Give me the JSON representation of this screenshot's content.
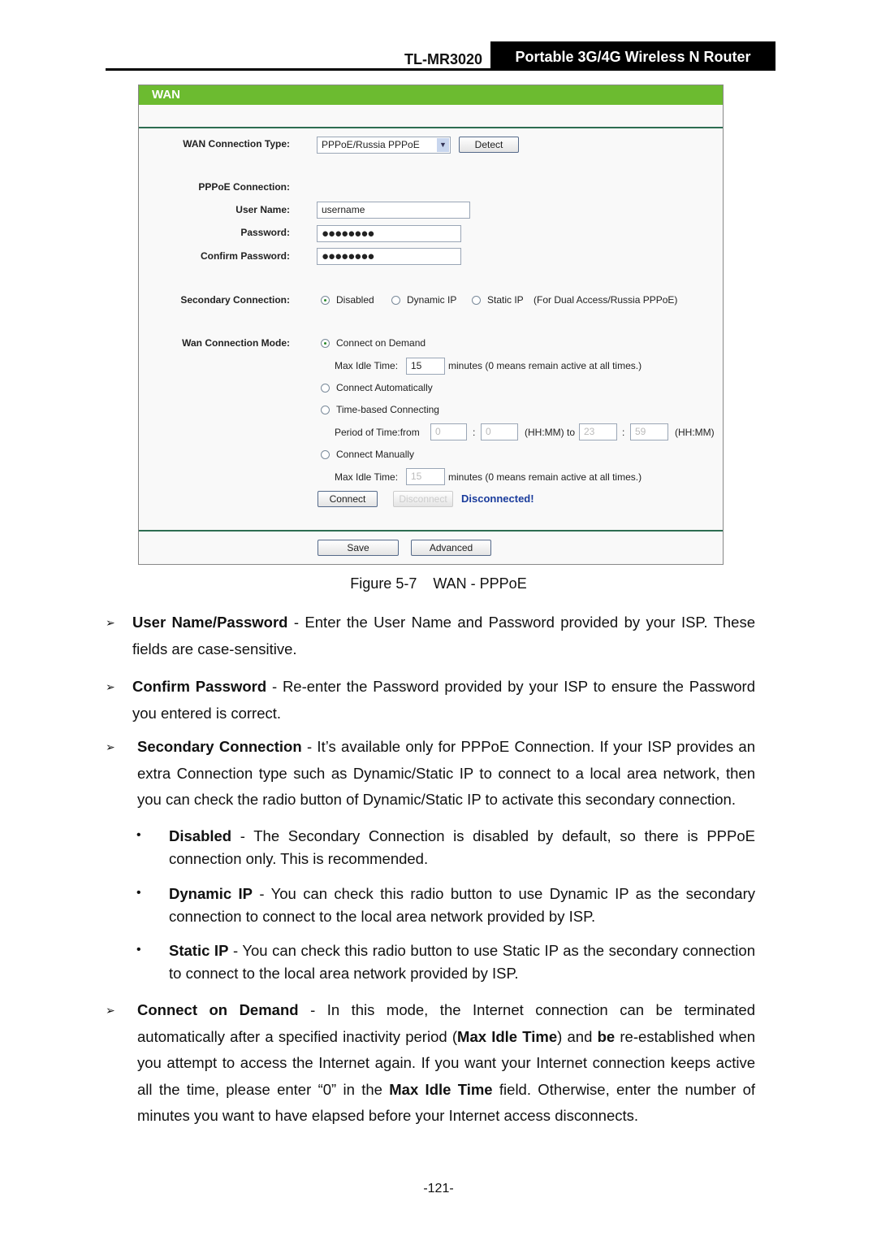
{
  "header": {
    "model": "TL-MR3020",
    "product": "Portable 3G/4G Wireless N Router"
  },
  "wan": {
    "title": "WAN",
    "conn_type_label": "WAN Connection Type:",
    "conn_type_value": "PPPoE/Russia PPPoE",
    "detect": "Detect",
    "pppoe_label": "PPPoE Connection:",
    "user_label": "User Name:",
    "user_value": "username",
    "pass_label": "Password:",
    "pass_value": "●●●●●●●●",
    "confirm_label": "Confirm Password:",
    "confirm_value": "●●●●●●●●",
    "secondary_label": "Secondary Connection:",
    "secondary_options": [
      "Disabled",
      "Dynamic IP",
      "Static IP"
    ],
    "secondary_selected": "Disabled",
    "secondary_note": "(For Dual Access/Russia PPPoE)",
    "mode_label": "Wan Connection Mode:",
    "mode_options": [
      "Connect on Demand",
      "Connect Automatically",
      "Time-based Connecting",
      "Connect Manually"
    ],
    "mode_selected": "Connect on Demand",
    "max_idle_label": "Max Idle Time:",
    "max_idle_value": "15",
    "minutes_note": "minutes (0 means remain active at all times.)",
    "period_label": "Period of Time:from",
    "from_hh": "0",
    "from_mm": "0",
    "hhmm_to": "(HH:MM) to",
    "to_hh": "23",
    "to_mm": "59",
    "hhmm": "(HH:MM)",
    "colon": ":",
    "max_idle2_value": "15",
    "connect": "Connect",
    "disconnect": "Disconnect",
    "status": "Disconnected!",
    "save": "Save",
    "advanced": "Advanced",
    "colors": {
      "title_bar": "#6cbb30",
      "status": "#1a3c9c"
    }
  },
  "caption": "Figure 5-7    WAN - PPPoE",
  "body": {
    "p1": [
      {
        "b": true,
        "t": "User Name/Password"
      },
      {
        "t": " - Enter the User Name and Password provided by your ISP. These fields are case-sensitive."
      }
    ],
    "p2": [
      {
        "b": true,
        "t": "Confirm Password"
      },
      {
        "t": " - Re-enter the Password provided by your ISP to ensure the Password you entered is correct."
      }
    ],
    "p3": [
      {
        "b": true,
        "t": "Secondary Connection"
      },
      {
        "t": " - It’s available only for PPPoE Connection. If your ISP provides an extra Connection type such as Dynamic/Static IP to connect to a local area network, then you can check the radio button of Dynamic/Static IP to activate this secondary connection."
      }
    ],
    "b1": [
      {
        "b": true,
        "t": "Disabled"
      },
      {
        "t": " - The Secondary Connection is disabled by default, so there is PPPoE connection only. This is recommended."
      }
    ],
    "b2": [
      {
        "b": true,
        "t": "Dynamic IP"
      },
      {
        "t": " - You can check this radio button to use Dynamic IP as the secondary connection to connect to the local area network provided by ISP."
      }
    ],
    "b3": [
      {
        "b": true,
        "t": "Static IP"
      },
      {
        "t": " - You can check this radio button to use Static IP as the secondary connection to connect to the local area network provided by ISP."
      }
    ],
    "p4": [
      {
        "b": true,
        "t": "Connect on Demand"
      },
      {
        "t": " - In this mode, the Internet connection can be terminated automatically after a specified inactivity period ("
      },
      {
        "b": true,
        "t": "Max Idle Time"
      },
      {
        "t": ") and "
      },
      {
        "b": true,
        "t": "be"
      },
      {
        "t": " re-established when you attempt to access the Internet again. If you want your Internet connection keeps active all the time, please enter “0” in the "
      },
      {
        "b": true,
        "t": "Max Idle Time"
      },
      {
        "t": " field. Otherwise, enter the number of minutes you want to have elapsed before your Internet access disconnects."
      }
    ]
  },
  "page_number": "-121-"
}
